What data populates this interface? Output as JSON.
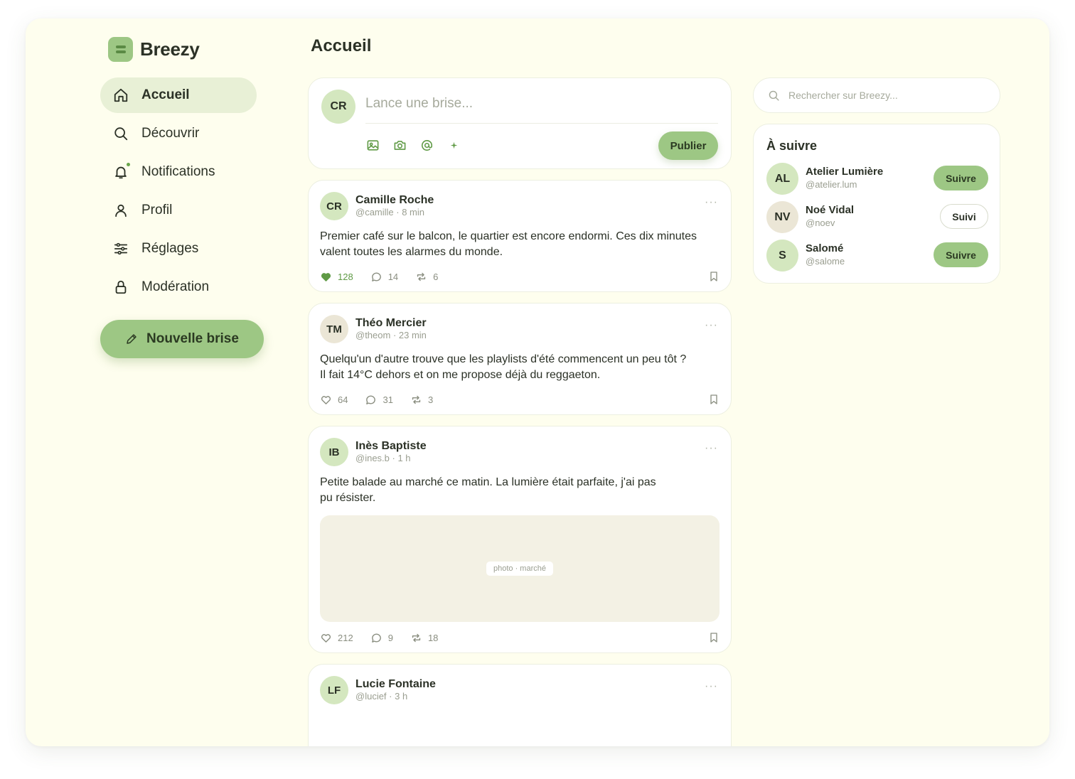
{
  "brand": {
    "name": "Breezy",
    "accent": "#9dc784",
    "background": "#fefeee"
  },
  "nav": {
    "items": [
      {
        "label": "Accueil",
        "icon": "home-icon",
        "active": true
      },
      {
        "label": "Découvrir",
        "icon": "search-icon"
      },
      {
        "label": "Notifications",
        "icon": "bell-icon",
        "dot": true
      },
      {
        "label": "Profil",
        "icon": "user-icon"
      },
      {
        "label": "Réglages",
        "icon": "sliders-icon"
      },
      {
        "label": "Modération",
        "icon": "lock-icon"
      }
    ],
    "new_button": "Nouvelle brise"
  },
  "main": {
    "title": "Accueil"
  },
  "composer": {
    "avatar": "CR",
    "placeholder": "Lance une brise...",
    "tools": [
      "image-icon",
      "camera-icon",
      "at-icon",
      "sparkle-icon"
    ],
    "publish": "Publier"
  },
  "posts": [
    {
      "initials": "CR",
      "name": "Camille Roche",
      "meta": "@camille · 8 min",
      "text": "Premier café sur le balcon, le quartier est encore endormi. Ces dix minutes valent toutes les alarmes du monde.",
      "likes": "128",
      "comments": "14",
      "reposts": "6",
      "liked": true
    },
    {
      "initials": "TM",
      "name": "Théo Mercier",
      "meta": "@theom · 23 min",
      "text_lines": [
        "Quelqu'un d'autre trouve que les playlists d'été commencent un peu tôt ?",
        "Il fait 14°C dehors et on me propose déjà du reggaeton."
      ],
      "likes": "64",
      "comments": "31",
      "reposts": "3"
    },
    {
      "initials": "IB",
      "name": "Inès Baptiste",
      "meta": "@ines.b · 1 h",
      "text_lines": [
        "Petite balade au marché ce matin. La lumière était parfaite, j'ai pas",
        "pu résister."
      ],
      "photo_label": "photo · marché",
      "likes": "212",
      "comments": "9",
      "reposts": "18"
    },
    {
      "initials": "LF",
      "name": "Lucie Fontaine",
      "meta": "@lucief · 3 h"
    }
  ],
  "search": {
    "placeholder": "Rechercher sur Breezy..."
  },
  "suggestions": {
    "title": "À suivre",
    "items": [
      {
        "initials": "AL",
        "name": "Atelier Lumière",
        "handle": "@atelier.lum",
        "button": "Suivre"
      },
      {
        "initials": "NV",
        "name": "Noé Vidal",
        "handle": "@noev",
        "button": "Suivi"
      },
      {
        "initials": "S",
        "name": "Salomé",
        "handle": "@salome",
        "button": "Suivre"
      }
    ]
  }
}
